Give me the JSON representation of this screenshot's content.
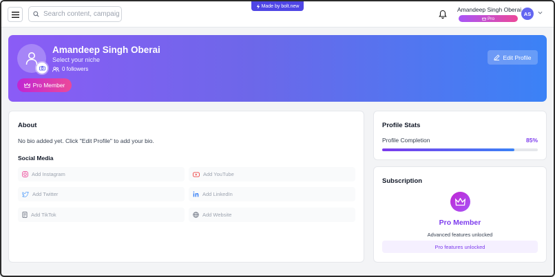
{
  "header": {
    "search_placeholder": "Search content, campaigns...",
    "bolt_badge": "Made by bolt.new",
    "user_name": "Amandeep Singh Oberai",
    "plan_badge": "Pro",
    "avatar_initials": "AS"
  },
  "banner": {
    "name": "Amandeep Singh Oberai",
    "niche": "Select your niche",
    "followers": "0 followers",
    "pro_member_label": "Pro Member",
    "edit_profile_label": "Edit Profile"
  },
  "about": {
    "title": "About",
    "bio": "No bio added yet. Click \"Edit Profile\" to add your bio.",
    "social_title": "Social Media",
    "social": [
      {
        "label": "Add Instagram",
        "icon": "instagram-icon"
      },
      {
        "label": "Add YouTube",
        "icon": "youtube-icon"
      },
      {
        "label": "Add Twitter",
        "icon": "twitter-icon"
      },
      {
        "label": "Add LinkedIn",
        "icon": "linkedin-icon"
      },
      {
        "label": "Add TikTok",
        "icon": "tiktok-icon"
      },
      {
        "label": "Add Website",
        "icon": "globe-icon"
      }
    ]
  },
  "stats": {
    "title": "Profile Stats",
    "completion_label": "Profile Completion",
    "completion_value": "85%",
    "completion_fraction": 0.85
  },
  "subscription": {
    "title": "Subscription",
    "plan_name": "Pro Member",
    "description": "Advanced features unlocked",
    "unlocked_text": "Pro features unlocked"
  },
  "colors": {
    "accent": "#7c3aed",
    "brand_blue": "#3b82f6",
    "pink": "#ec4899"
  }
}
